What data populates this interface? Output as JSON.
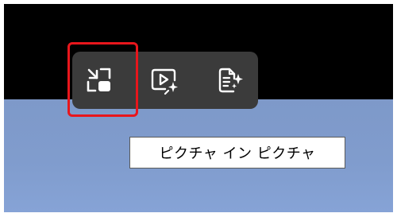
{
  "toolbar": {
    "buttons": [
      {
        "icon": "picture-in-picture-icon"
      },
      {
        "icon": "video-sparkle-icon"
      },
      {
        "icon": "document-sparkle-icon"
      }
    ],
    "tooltip": "ピクチャ イン ピクチャ"
  },
  "colors": {
    "video_background": "#000000",
    "toolbar_background": "#3b3b3b",
    "highlight": "#e8161c",
    "desktop": "#809ccd",
    "icon": "#ffffff"
  }
}
